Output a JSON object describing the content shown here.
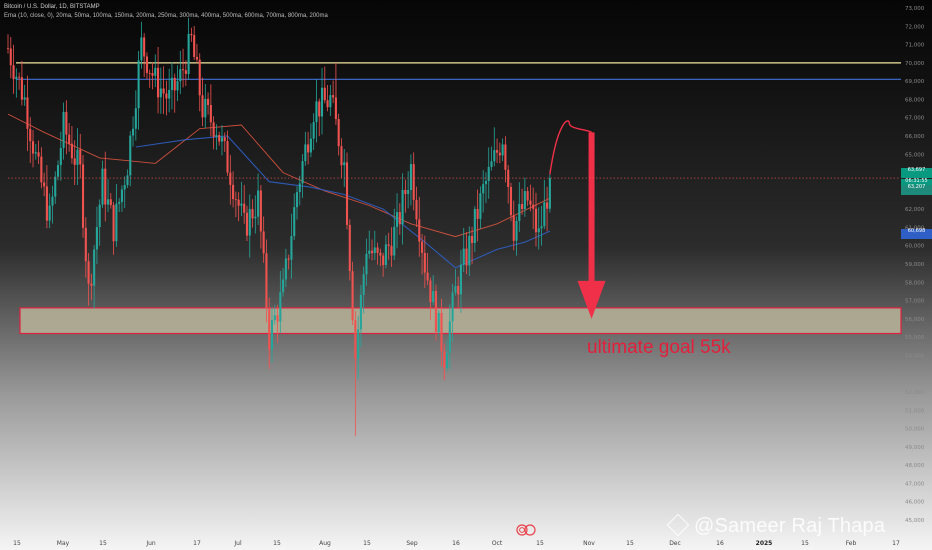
{
  "header": {
    "symbol_line": "Bitcoin / U.S. Dollar, 1D, BITSTAMP",
    "indicator_line": "Ema (10, close, 0), 20ma, 50ma, 100ma, 150ma, 200ma, 250ma, 300ma, 400ma, 500ma, 600ma, 700ma, 800ma, 200ma"
  },
  "watermark": {
    "text": "@Sameer Raj Thapa"
  },
  "annotation": {
    "text": "ultimate goal  55k"
  },
  "price_labels": {
    "current": "63,697",
    "countdown": "06:31:55",
    "ma_fast": "63,207",
    "ma_slow": "60,698"
  },
  "colors": {
    "up": "#26a69a",
    "down": "#ef5350",
    "yellow_line": "#f2e6a0",
    "blue_line": "#3f6fd6",
    "zone_fill": "#b8b49a",
    "zone_border": "#e02040",
    "arrow": "#f03048",
    "ma_red": "#e0553f",
    "ma_blue": "#2f5fc4"
  },
  "chart_data": {
    "type": "candlestick",
    "ylim": [
      45000,
      73000
    ],
    "y_ticks": [
      "45,000",
      "46,000",
      "47,000",
      "48,000",
      "49,000",
      "50,000",
      "51,000",
      "52,000",
      "53,000",
      "54,000",
      "55,000",
      "56,000",
      "57,000",
      "58,000",
      "59,000",
      "60,000",
      "61,000",
      "62,000",
      "63,000",
      "64,000",
      "65,000",
      "66,000",
      "67,000",
      "68,000",
      "69,000",
      "70,000",
      "71,000",
      "72,000",
      "73,000"
    ],
    "x_ticks": [
      "15",
      "May",
      "15",
      "Jun",
      "17",
      "Jul",
      "15",
      "Aug",
      "15",
      "Sep",
      "16",
      "Oct",
      "15",
      "Nov",
      "15",
      "Dec",
      "16",
      "2025",
      "15",
      "Feb",
      "17"
    ],
    "year_tick": "2025",
    "x_start": "2024-04-02",
    "x_end": "2025-02-17",
    "resistance_levels": [
      70000,
      69100
    ],
    "support_zone": [
      55200,
      56600
    ],
    "target": 55000,
    "current_price": 63697,
    "anchors": [
      [
        "2024-04-02",
        70800
      ],
      [
        "2024-04-08",
        68000
      ],
      [
        "2024-04-13",
        64000
      ],
      [
        "2024-04-17",
        61500
      ],
      [
        "2024-04-22",
        66500
      ],
      [
        "2024-04-28",
        64000
      ],
      [
        "2024-05-01",
        57500
      ],
      [
        "2024-05-06",
        63500
      ],
      [
        "2024-05-10",
        61000
      ],
      [
        "2024-05-15",
        64500
      ],
      [
        "2024-05-20",
        71000
      ],
      [
        "2024-05-25",
        69000
      ],
      [
        "2024-05-30",
        68000
      ],
      [
        "2024-06-03",
        69200
      ],
      [
        "2024-06-07",
        71200
      ],
      [
        "2024-06-11",
        67500
      ],
      [
        "2024-06-16",
        66500
      ],
      [
        "2024-06-21",
        64000
      ],
      [
        "2024-06-26",
        61000
      ],
      [
        "2024-07-01",
        62500
      ],
      [
        "2024-07-05",
        55000
      ],
      [
        "2024-07-10",
        57500
      ],
      [
        "2024-07-15",
        63000
      ],
      [
        "2024-07-21",
        67500
      ],
      [
        "2024-07-27",
        68000
      ],
      [
        "2024-08-01",
        64500
      ],
      [
        "2024-08-05",
        54000
      ],
      [
        "2024-08-09",
        60000
      ],
      [
        "2024-08-14",
        59000
      ],
      [
        "2024-08-20",
        61000
      ],
      [
        "2024-08-25",
        64300
      ],
      [
        "2024-08-30",
        59000
      ],
      [
        "2024-09-06",
        54000
      ],
      [
        "2024-09-10",
        57500
      ],
      [
        "2024-09-15",
        60000
      ],
      [
        "2024-09-20",
        63000
      ],
      [
        "2024-09-27",
        66000
      ],
      [
        "2024-10-01",
        61000
      ],
      [
        "2024-10-04",
        62000
      ],
      [
        "2024-10-06",
        62500
      ],
      [
        "2024-10-10",
        60500
      ],
      [
        "2024-10-14",
        63500
      ]
    ],
    "projection": {
      "curve": [
        [
          "2024-10-14",
          63900
        ],
        [
          "2024-10-21",
          66700
        ],
        [
          "2024-10-29",
          66200
        ]
      ],
      "arrow_from": [
        "2024-10-29",
        66200
      ],
      "arrow_to": [
        "2024-10-29",
        56000
      ]
    },
    "moving_averages": [
      {
        "color": "red",
        "points": [
          [
            "2024-04-02",
            67200
          ],
          [
            "2024-04-15",
            66200
          ],
          [
            "2024-05-05",
            64800
          ],
          [
            "2024-05-25",
            64500
          ],
          [
            "2024-06-10",
            66400
          ],
          [
            "2024-06-25",
            66600
          ],
          [
            "2024-07-10",
            64000
          ],
          [
            "2024-07-25",
            63000
          ],
          [
            "2024-08-10",
            62200
          ],
          [
            "2024-08-25",
            61200
          ],
          [
            "2024-09-10",
            60500
          ],
          [
            "2024-09-25",
            61200
          ],
          [
            "2024-10-14",
            62600
          ]
        ]
      },
      {
        "color": "blue",
        "points": [
          [
            "2024-05-18",
            65400
          ],
          [
            "2024-06-05",
            65800
          ],
          [
            "2024-06-20",
            66000
          ],
          [
            "2024-07-05",
            63500
          ],
          [
            "2024-07-20",
            63200
          ],
          [
            "2024-08-01",
            62800
          ],
          [
            "2024-08-15",
            62000
          ],
          [
            "2024-08-30",
            60200
          ],
          [
            "2024-09-10",
            58800
          ],
          [
            "2024-09-25",
            59800
          ],
          [
            "2024-10-05",
            60200
          ],
          [
            "2024-10-14",
            60800
          ]
        ]
      }
    ]
  }
}
